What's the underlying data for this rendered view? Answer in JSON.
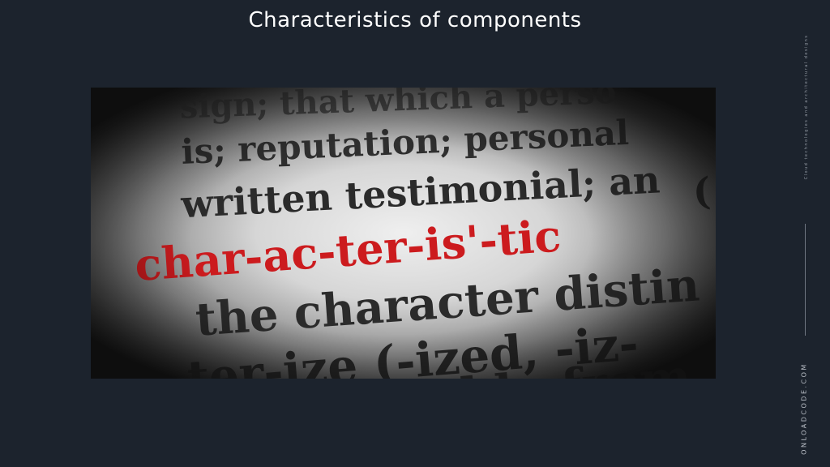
{
  "slide": {
    "title": "Characteristics of components"
  },
  "photo": {
    "lines": [
      "sign; that which a perso",
      "is; reputation; personal",
      "written testimonial; an",
      "char-ac-ter-is'-tic",
      "(",
      "the character distin",
      "ter-ize (-ized, -iz-",
      "able from"
    ],
    "highlight_color": "#cc1b1e",
    "ink_color": "#2b2b2b"
  },
  "sidebar": {
    "tagline": "Cloud technologies and architectural designs",
    "brand": "ONLOADCODE.COM"
  }
}
